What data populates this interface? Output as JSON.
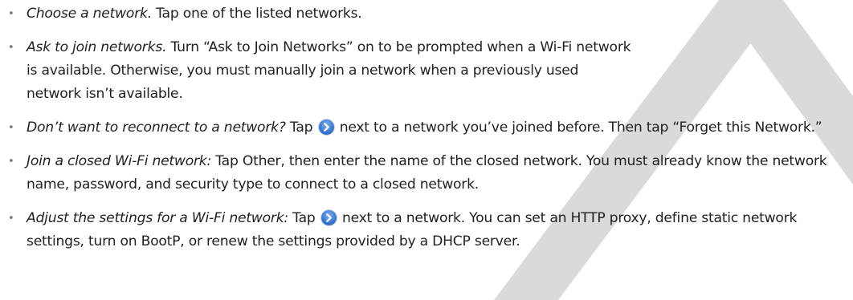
{
  "items": [
    {
      "lead": "Choose a network.",
      "text": " Tap one of the listed networks."
    },
    {
      "lead": "Ask to join networks.",
      "text": " Turn “Ask to Join Networks” on to be prompted when a Wi-Fi network is available. Otherwise, you must manually join a network when a previously used network isn’t available."
    },
    {
      "lead": "Don’t want to reconnect to a network?",
      "text_before": " Tap ",
      "text_after": " next to a network you’ve joined before. Then tap “Forget this Network.”",
      "icon": "disclosure-arrow-icon"
    },
    {
      "lead": "Join a closed Wi-Fi network:",
      "text": "  Tap Other, then enter the name of the closed network. You must already know the network name, password, and security type to connect to a closed network."
    },
    {
      "lead": "Adjust the settings for a Wi-Fi network:",
      "text_before": "  Tap ",
      "text_after": " next to a network. You can set an HTTP proxy, define static network settings, turn on BootP, or renew the settings provided by a DHCP server.",
      "icon": "disclosure-arrow-icon"
    }
  ],
  "colors": {
    "text": "#231f20",
    "bullet": "#7a7a7a",
    "watermark": "#d9d9d9",
    "icon": "#3b7bd4"
  }
}
